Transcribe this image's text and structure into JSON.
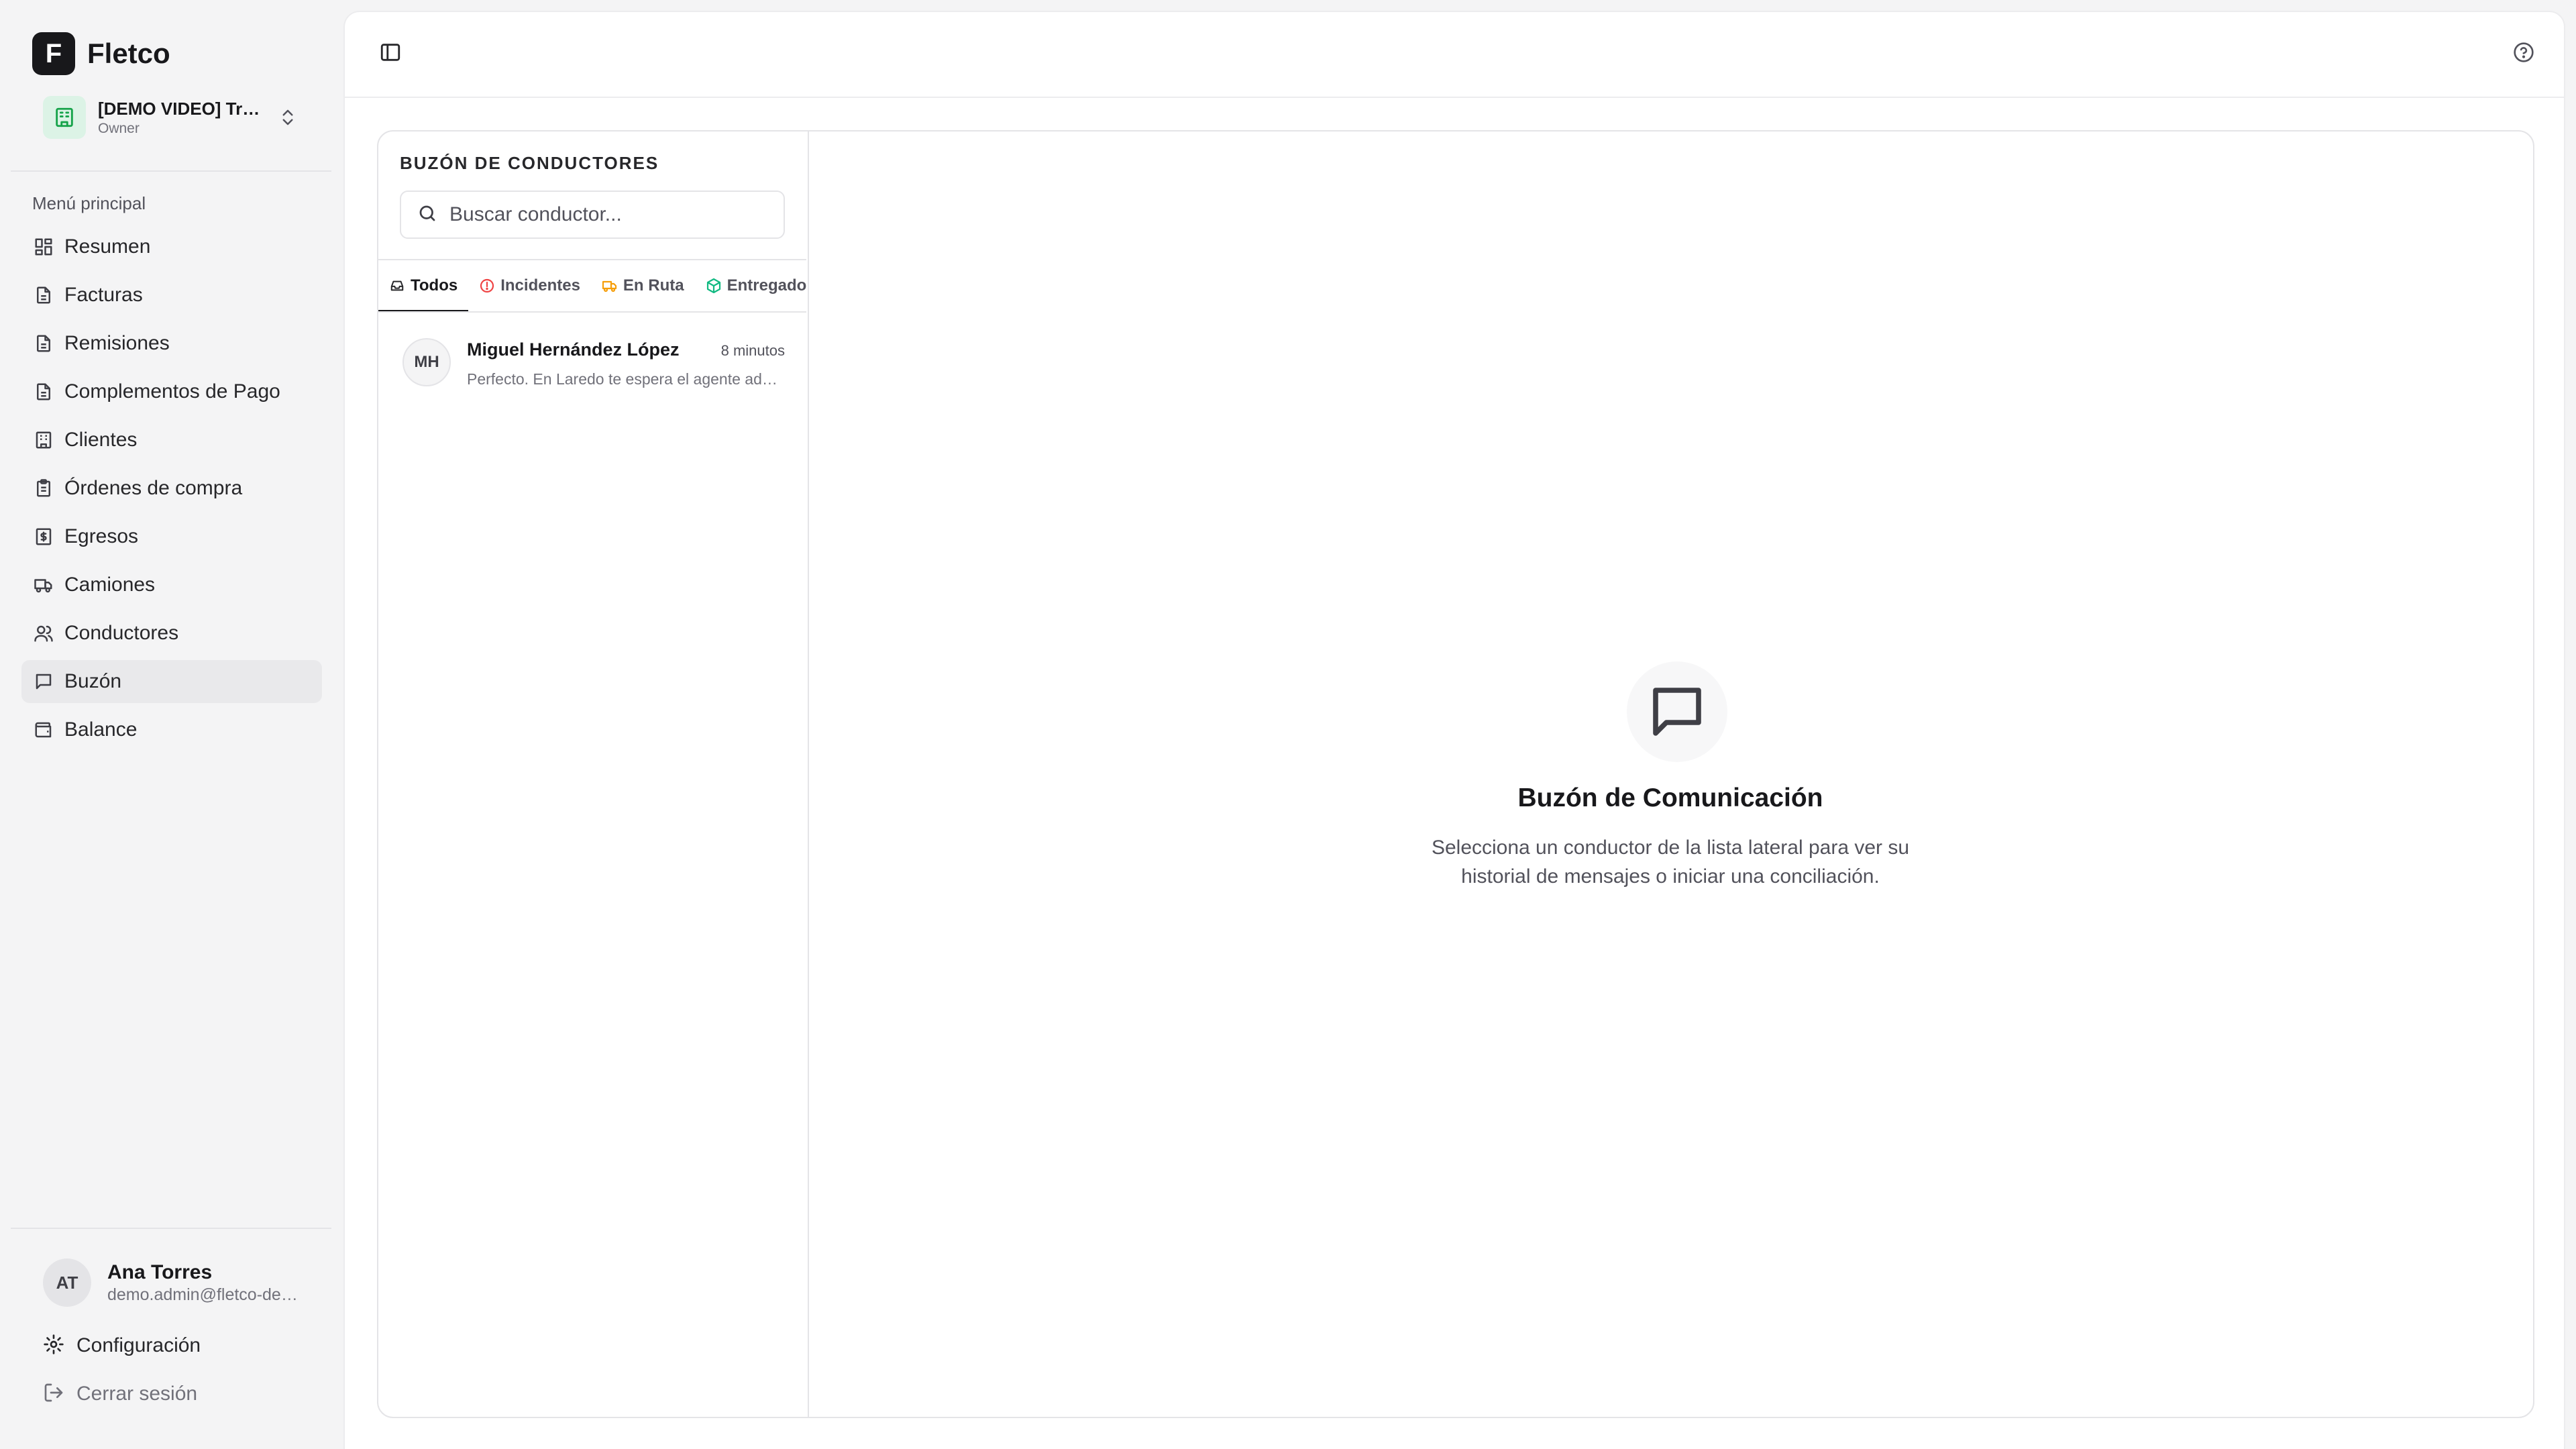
{
  "brand": {
    "mark": "F",
    "name": "Fletco"
  },
  "org": {
    "name": "[DEMO VIDEO] Transportes",
    "role": "Owner"
  },
  "menu": {
    "label": "Menú principal",
    "items": [
      {
        "label": "Resumen",
        "icon": "dashboard-icon"
      },
      {
        "label": "Facturas",
        "icon": "document-icon"
      },
      {
        "label": "Remisiones",
        "icon": "document-icon"
      },
      {
        "label": "Complementos de Pago",
        "icon": "document-icon"
      },
      {
        "label": "Clientes",
        "icon": "building-icon"
      },
      {
        "label": "Órdenes de compra",
        "icon": "clipboard-icon"
      },
      {
        "label": "Egresos",
        "icon": "receipt-dollar-icon"
      },
      {
        "label": "Camiones",
        "icon": "truck-icon"
      },
      {
        "label": "Conductores",
        "icon": "users-icon"
      },
      {
        "label": "Buzón",
        "icon": "message-icon",
        "active": true
      },
      {
        "label": "Balance",
        "icon": "wallet-icon"
      }
    ]
  },
  "user": {
    "initials": "AT",
    "name": "Ana Torres",
    "email": "demo.admin@fletco-demo.com"
  },
  "footer": {
    "settings_label": "Configuración",
    "logout_label": "Cerrar sesión"
  },
  "inbox": {
    "title": "BUZÓN DE CONDUCTORES",
    "search_placeholder": "Buscar conductor...",
    "tabs": [
      {
        "label": "Todos",
        "active": true,
        "icon": "inbox-icon"
      },
      {
        "label": "Incidentes",
        "icon": "alert-circle-icon",
        "color": "#ef4444"
      },
      {
        "label": "En Ruta",
        "icon": "truck-icon",
        "color": "#f59e0b"
      },
      {
        "label": "Entregados",
        "icon": "package-icon",
        "color": "#10b981"
      }
    ],
    "conversations": [
      {
        "initials": "MH",
        "name": "Miguel Hernández López",
        "time": "8 minutos",
        "preview": "Perfecto. En Laredo te espera el agente aduanal."
      }
    ]
  },
  "empty_state": {
    "icon": "message-square-icon",
    "title": "Buzón de Comunicación",
    "description": "Selecciona un conductor de la lista lateral para ver su historial de mensajes o iniciar una conciliación."
  },
  "colors": {
    "accent": "#18181b",
    "org_badge": "#dcf3e6",
    "org_icon": "#16a34a"
  }
}
